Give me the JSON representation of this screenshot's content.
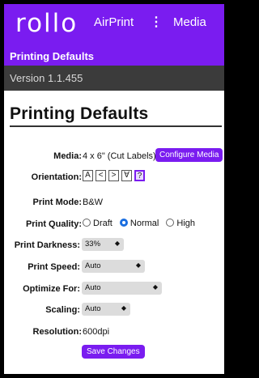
{
  "appbar": {
    "logo": "rollo",
    "nav_airprint": "AirPrint",
    "nav_dots": "⋮",
    "nav_media": "Media"
  },
  "subbar_title": "Printing Defaults",
  "version": "Version 1.1.455",
  "page_title": "Printing Defaults",
  "media": {
    "label": "Media:",
    "value": "4 x 6\" (Cut Labels)",
    "button": "Configure Media"
  },
  "orientation": {
    "label": "Orientation:",
    "options": [
      "A",
      "<",
      ">",
      "∀",
      "?"
    ]
  },
  "print_mode": {
    "label": "Print Mode:",
    "value": "B&W"
  },
  "print_quality": {
    "label": "Print Quality:",
    "options": [
      "Draft",
      "Normal",
      "High"
    ],
    "selected": "Normal"
  },
  "print_darkness": {
    "label": "Print Darkness:",
    "value": "33%"
  },
  "print_speed": {
    "label": "Print Speed:",
    "value": "Auto"
  },
  "optimize_for": {
    "label": "Optimize For:",
    "value": "Auto"
  },
  "scaling": {
    "label": "Scaling:",
    "value": "Auto"
  },
  "resolution": {
    "label": "Resolution:",
    "value": "600dpi"
  },
  "save_button": "Save Changes",
  "colors": {
    "brand": "#7a1cf0",
    "version_bar": "#3b3b3b",
    "radio_selected": "#1a6ee0"
  }
}
